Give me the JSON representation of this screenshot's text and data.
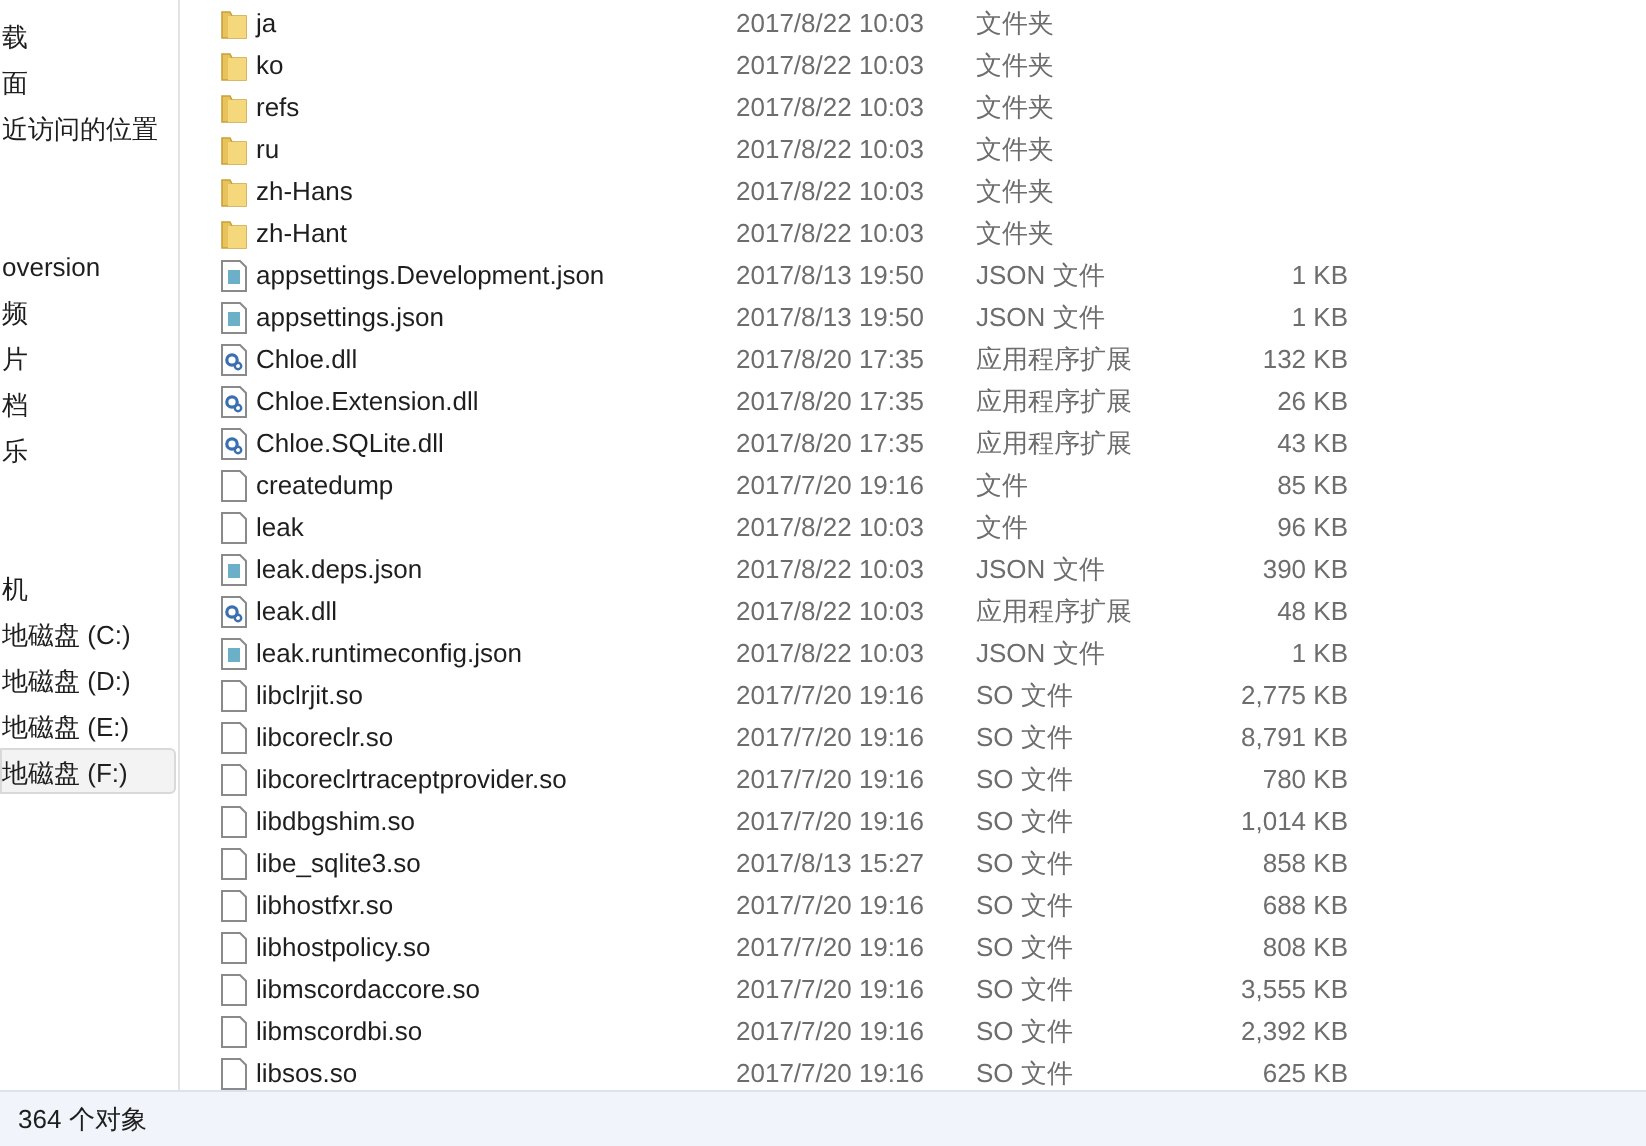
{
  "nav_pane": {
    "groups": [
      {
        "items": [
          {
            "label": "载",
            "selected": false
          },
          {
            "label": "面",
            "selected": false
          },
          {
            "label": "近访问的位置",
            "selected": false
          }
        ]
      },
      {
        "items": [
          {
            "label": "oversion",
            "selected": false
          },
          {
            "label": "频",
            "selected": false
          },
          {
            "label": "片",
            "selected": false
          },
          {
            "label": "档",
            "selected": false
          },
          {
            "label": "乐",
            "selected": false
          }
        ]
      },
      {
        "items": [
          {
            "label": "机",
            "selected": false
          },
          {
            "label": "地磁盘 (C:)",
            "selected": false
          },
          {
            "label": "地磁盘 (D:)",
            "selected": false
          },
          {
            "label": "地磁盘 (E:)",
            "selected": false
          },
          {
            "label": "地磁盘 (F:)",
            "selected": true
          }
        ]
      }
    ]
  },
  "files": [
    {
      "kind": "folder",
      "name": "ja",
      "date": "2017/8/22 10:03",
      "type": "文件夹"
    },
    {
      "kind": "folder",
      "name": "ko",
      "date": "2017/8/22 10:03",
      "type": "文件夹"
    },
    {
      "kind": "folder",
      "name": "refs",
      "date": "2017/8/22 10:03",
      "type": "文件夹"
    },
    {
      "kind": "folder",
      "name": "ru",
      "date": "2017/8/22 10:03",
      "type": "文件夹"
    },
    {
      "kind": "folder",
      "name": "zh-Hans",
      "date": "2017/8/22 10:03",
      "type": "文件夹"
    },
    {
      "kind": "folder",
      "name": "zh-Hant",
      "date": "2017/8/22 10:03",
      "type": "文件夹"
    },
    {
      "kind": "config",
      "name": "appsettings.Development.json",
      "date": "2017/8/13 19:50",
      "type": "JSON 文件",
      "size": "1 KB"
    },
    {
      "kind": "config",
      "name": "appsettings.json",
      "date": "2017/8/13 19:50",
      "type": "JSON 文件",
      "size": "1 KB"
    },
    {
      "kind": "dll",
      "name": "Chloe.dll",
      "date": "2017/8/20 17:35",
      "type": "应用程序扩展",
      "size": "132 KB"
    },
    {
      "kind": "dll",
      "name": "Chloe.Extension.dll",
      "date": "2017/8/20 17:35",
      "type": "应用程序扩展",
      "size": "26 KB"
    },
    {
      "kind": "dll",
      "name": "Chloe.SQLite.dll",
      "date": "2017/8/20 17:35",
      "type": "应用程序扩展",
      "size": "43 KB"
    },
    {
      "kind": "blank",
      "name": "createdump",
      "date": "2017/7/20 19:16",
      "type": "文件",
      "size": "85 KB"
    },
    {
      "kind": "blank",
      "name": "leak",
      "date": "2017/8/22 10:03",
      "type": "文件",
      "size": "96 KB"
    },
    {
      "kind": "config",
      "name": "leak.deps.json",
      "date": "2017/8/22 10:03",
      "type": "JSON 文件",
      "size": "390 KB"
    },
    {
      "kind": "dll",
      "name": "leak.dll",
      "date": "2017/8/22 10:03",
      "type": "应用程序扩展",
      "size": "48 KB"
    },
    {
      "kind": "config",
      "name": "leak.runtimeconfig.json",
      "date": "2017/8/22 10:03",
      "type": "JSON 文件",
      "size": "1 KB"
    },
    {
      "kind": "blank",
      "name": "libclrjit.so",
      "date": "2017/7/20 19:16",
      "type": "SO 文件",
      "size": "2,775 KB"
    },
    {
      "kind": "blank",
      "name": "libcoreclr.so",
      "date": "2017/7/20 19:16",
      "type": "SO 文件",
      "size": "8,791 KB"
    },
    {
      "kind": "blank",
      "name": "libcoreclrtraceptprovider.so",
      "date": "2017/7/20 19:16",
      "type": "SO 文件",
      "size": "780 KB"
    },
    {
      "kind": "blank",
      "name": "libdbgshim.so",
      "date": "2017/7/20 19:16",
      "type": "SO 文件",
      "size": "1,014 KB"
    },
    {
      "kind": "blank",
      "name": "libe_sqlite3.so",
      "date": "2017/8/13 15:27",
      "type": "SO 文件",
      "size": "858 KB"
    },
    {
      "kind": "blank",
      "name": "libhostfxr.so",
      "date": "2017/7/20 19:16",
      "type": "SO 文件",
      "size": "688 KB"
    },
    {
      "kind": "blank",
      "name": "libhostpolicy.so",
      "date": "2017/7/20 19:16",
      "type": "SO 文件",
      "size": "808 KB"
    },
    {
      "kind": "blank",
      "name": "libmscordaccore.so",
      "date": "2017/7/20 19:16",
      "type": "SO 文件",
      "size": "3,555 KB"
    },
    {
      "kind": "blank",
      "name": "libmscordbi.so",
      "date": "2017/7/20 19:16",
      "type": "SO 文件",
      "size": "2,392 KB"
    },
    {
      "kind": "blank",
      "name": "libsos.so",
      "date": "2017/7/20 19:16",
      "type": "SO 文件",
      "size": "625 KB"
    }
  ],
  "status_bar": {
    "count": "364 个对象"
  }
}
